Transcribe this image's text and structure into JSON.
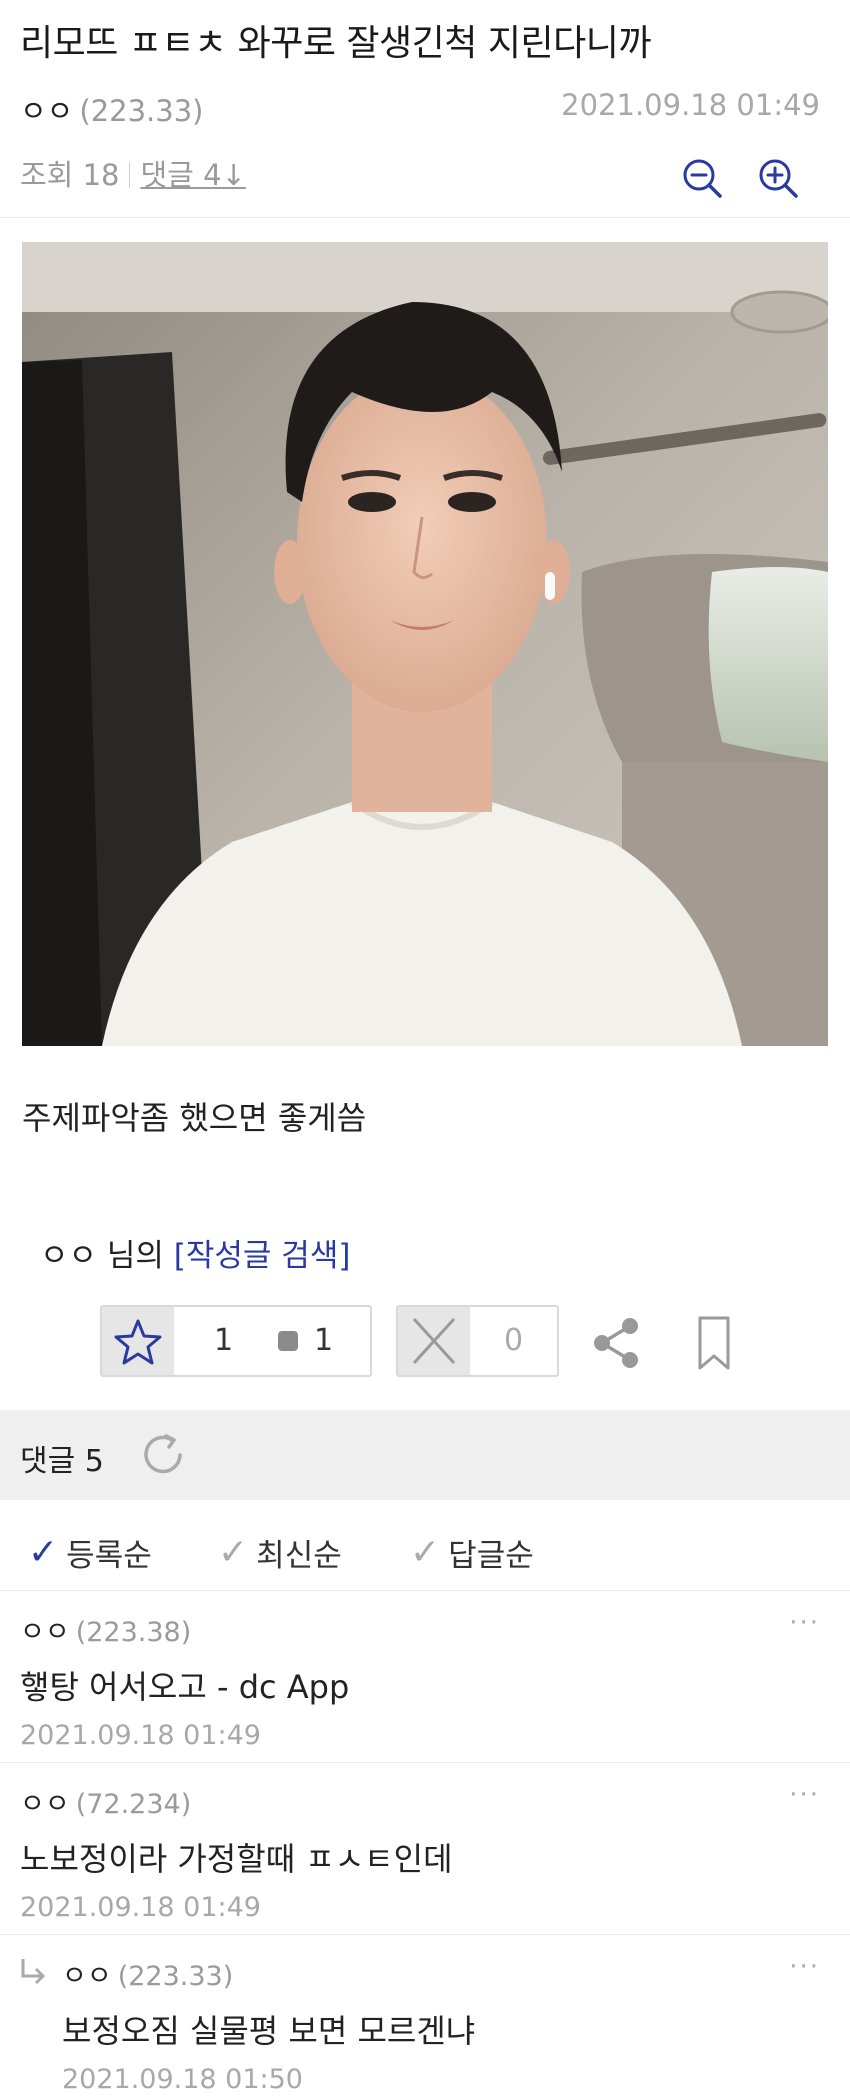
{
  "post": {
    "title": "리모뜨 ㅍㅌㅊ 와꾸로 잘생긴척 지린다니까",
    "author": "ㅇㅇ",
    "ip": "(223.33)",
    "date": "2021.09.18 01:49",
    "views_label": "조회 18",
    "comments_label": "댓글 4↓",
    "body": "주제파악좀 했으면 좋게씀",
    "author_search_prefix": "ㅇㅇ 님의",
    "author_search_link": "[작성글 검색]"
  },
  "actions": {
    "recommend_count": "1",
    "fix_recommend_count": "1",
    "nonrecommend_count": "0"
  },
  "comments_section": {
    "header": "댓글 5",
    "sort_options": [
      {
        "label": "등록순",
        "active": true
      },
      {
        "label": "최신순",
        "active": false
      },
      {
        "label": "답글순",
        "active": false
      }
    ],
    "items": [
      {
        "author": "ㅇㅇ",
        "ip": "(223.38)",
        "text": "햏탕 어서오고 - dc App",
        "date": "2021.09.18 01:49",
        "reply": false
      },
      {
        "author": "ㅇㅇ",
        "ip": "(72.234)",
        "text": "노보정이라 가정할때 ㅍㅅㅌ인데",
        "date": "2021.09.18 01:49",
        "reply": false
      },
      {
        "author": "ㅇㅇ",
        "ip": "(223.33)",
        "text": "보정오짐 실물평 보면 모르겐냐",
        "date": "2021.09.18 01:50",
        "reply": true
      }
    ],
    "more_label": "···"
  },
  "colors": {
    "accent": "#2a3aa0",
    "muted": "#9a9a9a",
    "section_bg": "#efefef"
  },
  "icons": [
    "zoom-out-icon",
    "zoom-in-icon",
    "star-icon",
    "x-icon",
    "share-icon",
    "bookmark-icon",
    "refresh-icon",
    "check-icon",
    "reply-arrow-icon",
    "more-icon"
  ]
}
